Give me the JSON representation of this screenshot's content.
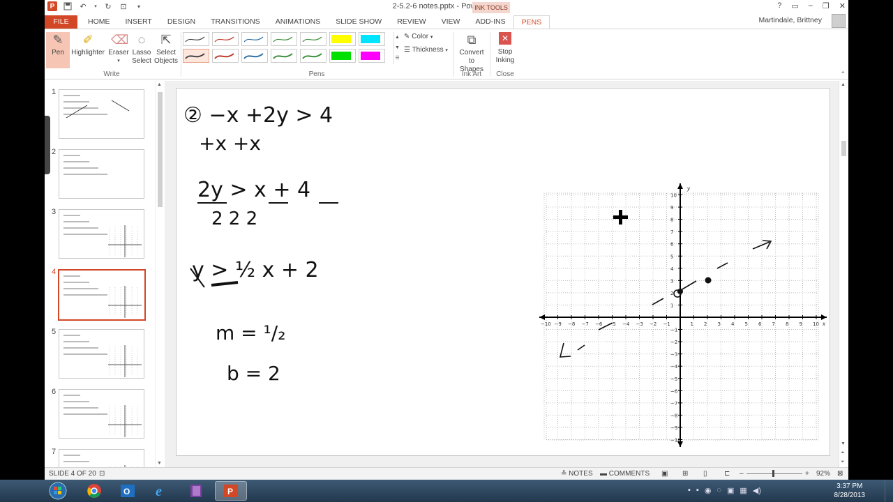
{
  "window": {
    "title": "2-5.2-6 notes.pptx - PowerPoint",
    "user": "Martindale, Brittney",
    "controls": [
      "?",
      "▭",
      "–",
      "❐",
      "✕"
    ]
  },
  "tabs": [
    "FILE",
    "HOME",
    "INSERT",
    "DESIGN",
    "TRANSITIONS",
    "ANIMATIONS",
    "SLIDE SHOW",
    "REVIEW",
    "VIEW",
    "ADD-INS",
    "PENS"
  ],
  "ink_tools_label": "INK TOOLS",
  "ribbon": {
    "write_group": {
      "label": "Write",
      "pen": "Pen",
      "highlighter": "Highlighter",
      "eraser": "Eraser",
      "lasso_select": [
        "Lasso",
        "Select"
      ],
      "select_objects": [
        "Select",
        "Objects"
      ]
    },
    "pens_group": {
      "label": "Pens",
      "color": "Color",
      "thickness": "Thickness",
      "swatches": [
        "#444444",
        "#c0392b",
        "#2e6da4",
        "#3a8f3a",
        "#3a8f3a",
        "#ffff00",
        "#00e5ff",
        "#444444",
        "#c0392b",
        "#2e6da4",
        "#3a8f3a",
        "#3a8f3a",
        "#00e000",
        "#ff00ff"
      ]
    },
    "ink_art_group": {
      "label": "Ink Art",
      "convert": [
        "Convert",
        "to Shapes"
      ]
    },
    "close_group": {
      "label": "Close",
      "stop": [
        "Stop",
        "Inking"
      ]
    }
  },
  "slides": [
    {
      "number": "1"
    },
    {
      "number": "2"
    },
    {
      "number": "3"
    },
    {
      "number": "4"
    },
    {
      "number": "5"
    },
    {
      "number": "6"
    },
    {
      "number": "7"
    }
  ],
  "slide_content": {
    "line1": "② −x +2y > 4",
    "line1b": "+x          +x",
    "frac_line": "2y  >  x  +  4",
    "frac_den": "2        2       2",
    "line3": "y > ½ x + 2",
    "slope": "m = ¹/₂",
    "intercept": "b = 2"
  },
  "graph": {
    "x_axis_label": "x",
    "y_axis_label": "y",
    "x_ticks": [
      "−10",
      "−9",
      "−8",
      "−7",
      "−6",
      "−5",
      "−4",
      "−3",
      "−2",
      "−1",
      "1",
      "2",
      "3",
      "4",
      "5",
      "6",
      "7",
      "8",
      "9",
      "10"
    ],
    "y_ticks": [
      "10",
      "9",
      "8",
      "7",
      "6",
      "5",
      "4",
      "3",
      "2",
      "1",
      "−1",
      "−2",
      "−3",
      "−4",
      "−5",
      "−6",
      "−7",
      "−8",
      "−9",
      "−10"
    ]
  },
  "status": {
    "slide_of": "SLIDE 4 OF 20",
    "notes": "NOTES",
    "comments": "COMMENTS",
    "zoom": "92%"
  },
  "taskbar": {
    "time": "3:37 PM",
    "date": "8/28/2013"
  }
}
